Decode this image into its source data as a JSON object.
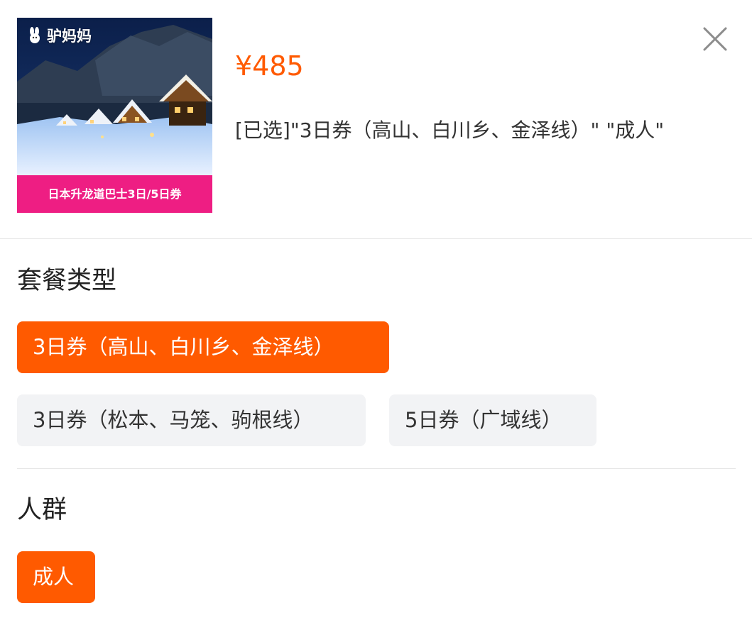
{
  "product": {
    "brand": "驴妈妈",
    "banner": "日本升龙道巴士3日/5日券",
    "price": "¥485",
    "selected_text": "[已选]\"3日券（高山、白川乡、金泽线）\" \"成人\""
  },
  "sections": {
    "package": {
      "title": "套餐类型",
      "options": [
        "3日券（高山、白川乡、金泽线）",
        "3日券（松本、马笼、驹根线）",
        "5日券（广域线）"
      ],
      "selected_index": 0
    },
    "crowd": {
      "title": "人群",
      "options": [
        "成人"
      ],
      "selected_index": 0
    }
  },
  "colors": {
    "accent": "#ff5a00",
    "banner": "#ee1e83",
    "chip_idle": "#f2f3f5"
  },
  "icons": {
    "close": "close-icon",
    "brand": "donkey-logo-icon"
  }
}
